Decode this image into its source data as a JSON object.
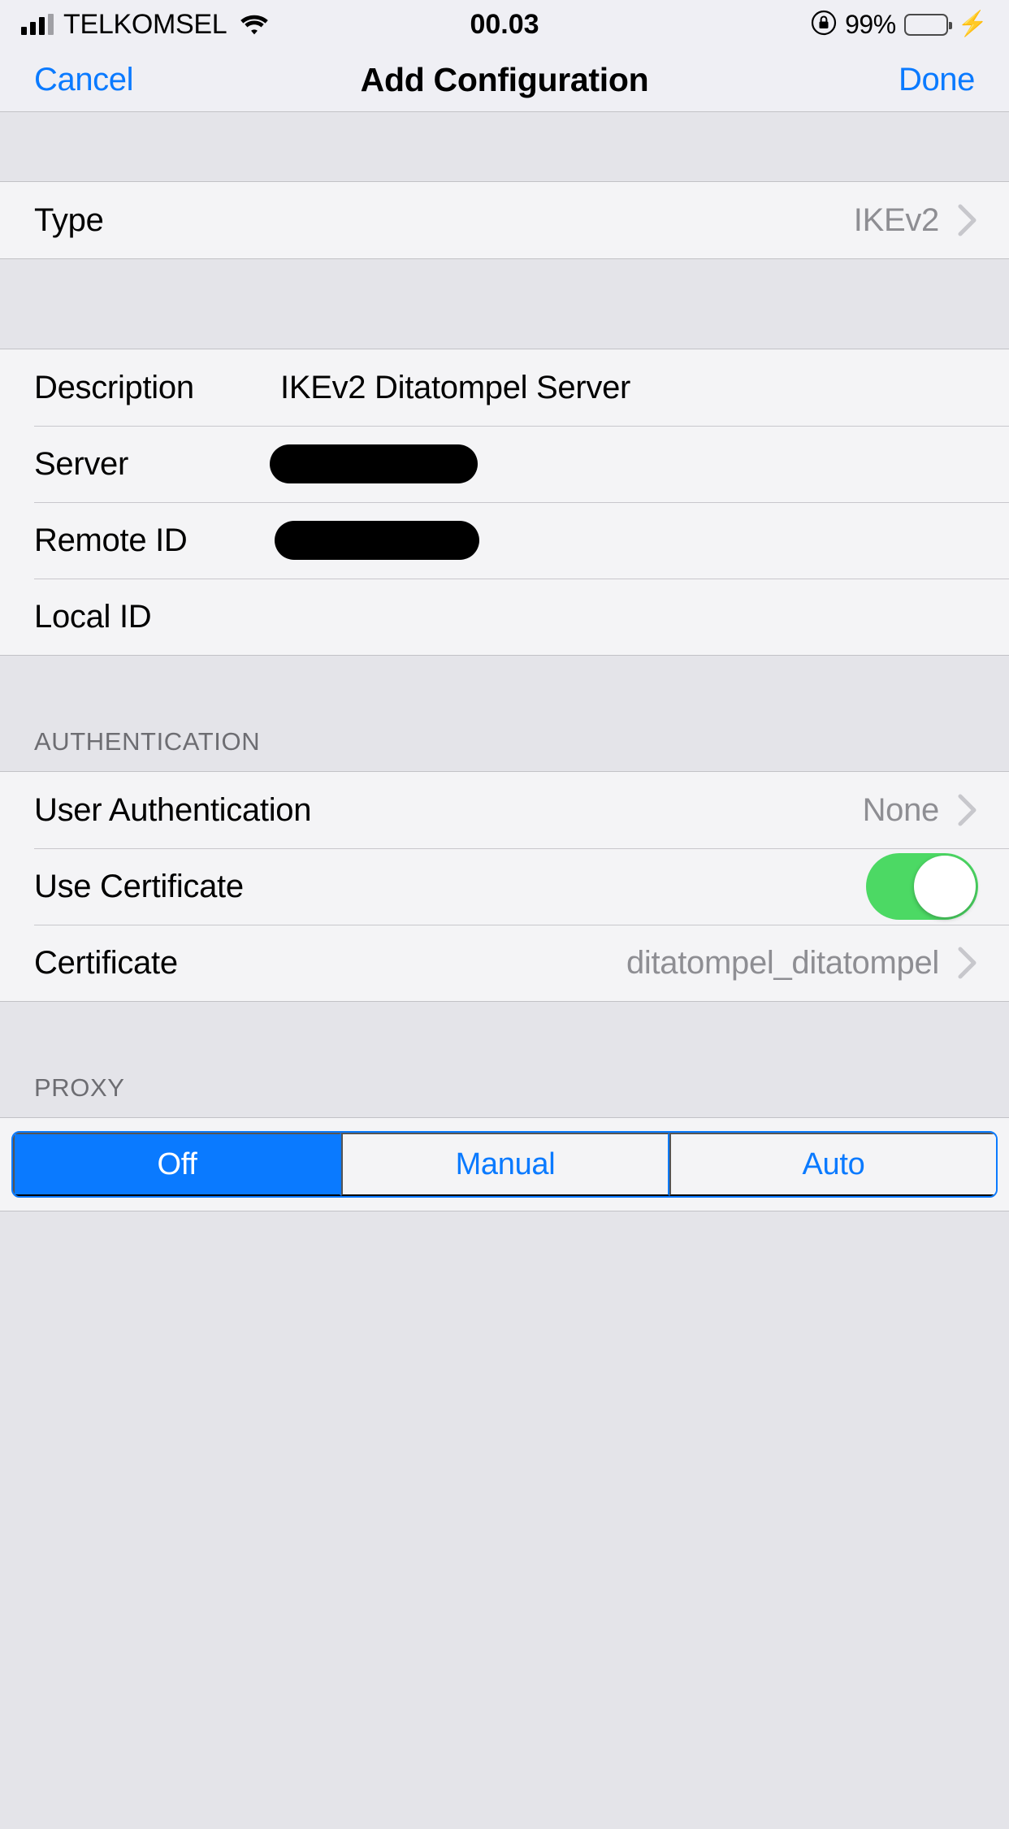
{
  "status_bar": {
    "carrier": "TELKOMSEL",
    "time": "00.03",
    "battery_percent": "99%",
    "signal_icon": "signal-bars-icon",
    "wifi_icon": "wifi-icon",
    "rotation_lock_icon": "rotation-lock-icon",
    "battery_icon": "battery-icon",
    "charging_icon": "lightning-bolt-icon"
  },
  "nav_bar": {
    "cancel_label": "Cancel",
    "title": "Add Configuration",
    "done_label": "Done"
  },
  "type_section": {
    "rows": [
      {
        "label": "Type",
        "value": "IKEv2",
        "accessory": "chevron-right-icon"
      }
    ]
  },
  "server_section": {
    "rows": [
      {
        "label": "Description",
        "value": "IKEv2 Ditatompel Server",
        "kind": "text"
      },
      {
        "label": "Server",
        "value": "",
        "kind": "redacted"
      },
      {
        "label": "Remote ID",
        "value": "",
        "kind": "redacted"
      },
      {
        "label": "Local ID",
        "value": "",
        "kind": "text"
      }
    ]
  },
  "authentication_section": {
    "header": "AUTHENTICATION",
    "rows": [
      {
        "label": "User Authentication",
        "value": "None",
        "accessory": "chevron-right-icon"
      },
      {
        "label": "Use Certificate",
        "value": "",
        "accessory": "toggle-on"
      },
      {
        "label": "Certificate",
        "value": "ditatompel_ditatompel",
        "accessory": "chevron-right-icon"
      }
    ]
  },
  "proxy_section": {
    "header": "PROXY",
    "segments": [
      {
        "label": "Off",
        "selected": true
      },
      {
        "label": "Manual",
        "selected": false
      },
      {
        "label": "Auto",
        "selected": false
      }
    ]
  },
  "colors": {
    "accent_blue": "#0a7aff",
    "toggle_green": "#4cd964",
    "group_bg": "#f4f4f6",
    "page_bg": "#e4e4e9",
    "value_gray": "#8e8e93",
    "header_gray": "#6d6d72"
  }
}
